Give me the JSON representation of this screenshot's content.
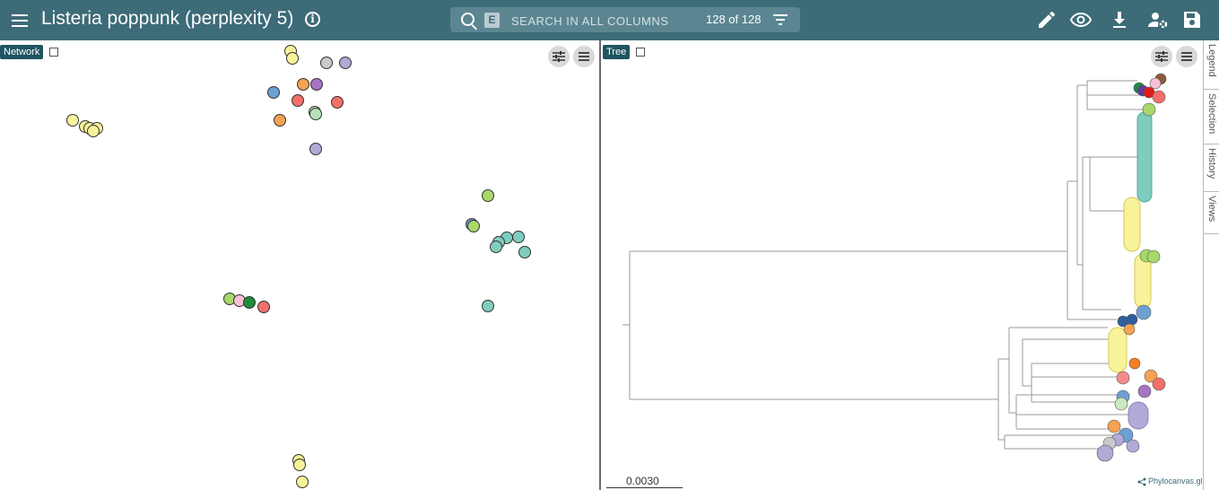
{
  "header": {
    "title": "Listeria poppunk (perplexity 5)",
    "search": {
      "badge": "E",
      "placeholder": "SEARCH IN ALL COLUMNS",
      "value": ""
    },
    "count": "128 of 128"
  },
  "panels": {
    "network": {
      "label": "Network"
    },
    "tree": {
      "label": "Tree",
      "scale_label": "0.0030",
      "brand": "Phylocanvas.gl"
    }
  },
  "sidebar_tabs": [
    "Legend",
    "Selection",
    "History",
    "Views"
  ],
  "colors": {
    "header_bg": "#3d6b78",
    "yellow": "#f8f29a",
    "teal": "#7fcdbf",
    "light_green": "#a6d86a",
    "green": "#1f8c3a",
    "salmon": "#f26f6a",
    "orange": "#f5a252",
    "purple": "#a674c4",
    "lavender": "#b1a9d6",
    "blue": "#6da0d3",
    "grey": "#c9c9c9",
    "pink": "#f6c0d8"
  },
  "icons": [
    "menu-icon",
    "info-icon",
    "search-icon",
    "filter-icon",
    "edit-icon",
    "eye-icon",
    "download-icon",
    "user-settings-icon",
    "save-icon",
    "sliders-icon",
    "hamburger-icon",
    "maximize-icon"
  ]
}
